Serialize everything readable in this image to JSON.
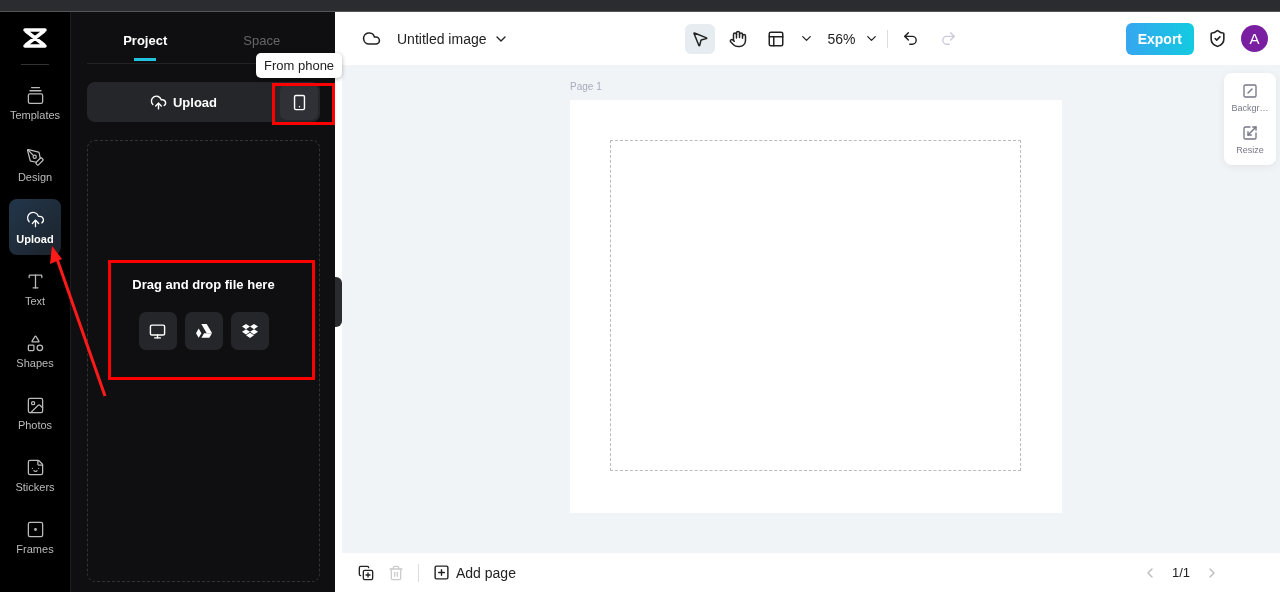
{
  "rail": {
    "items": [
      {
        "label": "Templates",
        "selected": false
      },
      {
        "label": "Design",
        "selected": false
      },
      {
        "label": "Upload",
        "selected": true
      },
      {
        "label": "Text",
        "selected": false
      },
      {
        "label": "Shapes",
        "selected": false
      },
      {
        "label": "Photos",
        "selected": false
      },
      {
        "label": "Stickers",
        "selected": false
      },
      {
        "label": "Frames",
        "selected": false
      }
    ]
  },
  "panel": {
    "tabs": [
      {
        "label": "Project",
        "selected": true
      },
      {
        "label": "Space",
        "selected": false
      }
    ],
    "upload_button": "Upload",
    "tooltip": "From phone",
    "dropzone_text": "Drag and drop file here"
  },
  "topbar": {
    "title": "Untitled image",
    "zoom": "56%",
    "export": "Export",
    "avatar": "A"
  },
  "canvas": {
    "page_label": "Page 1"
  },
  "side_tools": [
    {
      "label": "Backgr…"
    },
    {
      "label": "Resize"
    }
  ],
  "bottom": {
    "add_page": "Add page",
    "pager": "1/1"
  }
}
